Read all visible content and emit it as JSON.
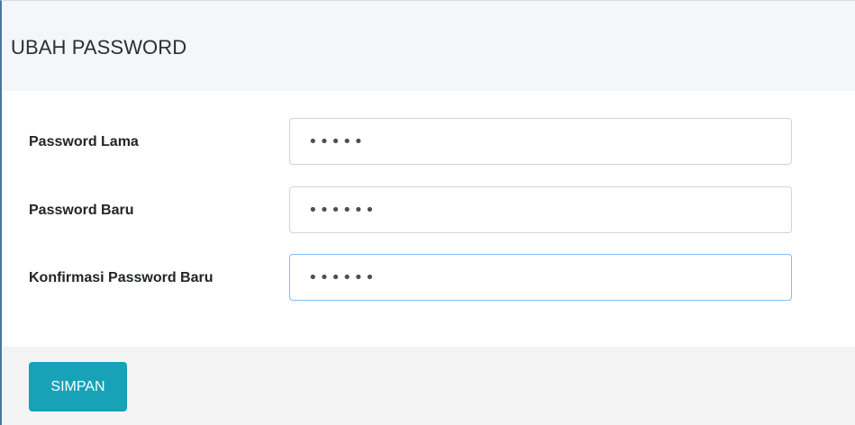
{
  "card": {
    "title": "UBAH PASSWORD"
  },
  "form": {
    "fields": [
      {
        "label": "Password Lama",
        "value": "•••••"
      },
      {
        "label": "Password Baru",
        "value": "••••••"
      },
      {
        "label": "Konfirmasi Password Baru",
        "value": "••••••"
      }
    ]
  },
  "footer": {
    "save_label": "SIMPAN"
  },
  "colors": {
    "accent": "#17a2b8",
    "focus_border": "#80bdff",
    "header_bg": "#f4f6f9",
    "footer_bg": "#f4f4f4"
  }
}
